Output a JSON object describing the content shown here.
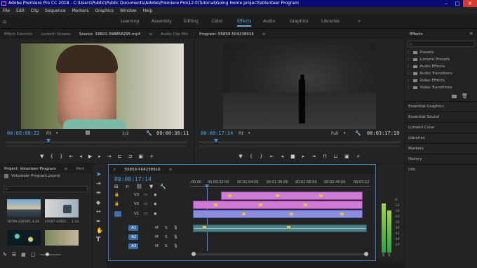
{
  "title_bar": {
    "text": "Adobe Premiere Pro CC 2018 - C:\\Users\\Public\\Public Documents\\Adobe\\Premiere Pro\\12.0\\Tutorial\\Going Home project\\Volunteer Program"
  },
  "menu": [
    "File",
    "Edit",
    "Clip",
    "Sequence",
    "Markers",
    "Graphics",
    "Window",
    "Help"
  ],
  "workspaces": [
    "Learning",
    "Assembly",
    "Editing",
    "Color",
    "Effects",
    "Audio",
    "Graphics",
    "Libraries"
  ],
  "active_workspace": "Effects",
  "source_panel": {
    "tabs": [
      "Effect Controls",
      "Lumetri Scopes",
      "Source: 33601-398856295.mp4",
      "Audio Clip Mix"
    ],
    "timecode_in": "00:00:08:22",
    "fit": "Fit",
    "resolution": "1/2",
    "timecode_out": "00:00:30:11"
  },
  "program_panel": {
    "tab": "Program: 55859-504238916",
    "timecode_in": "00:00:17:14",
    "fit": "Fit",
    "resolution": "Full",
    "timecode_out": "00:03:17:19"
  },
  "effects_panel": {
    "tab": "Effects",
    "folders": [
      "Presets",
      "Lumetri Presets",
      "Audio Effects",
      "Audio Transitions",
      "Video Effects",
      "Video Transitions"
    ],
    "side_panels": [
      "Essential Graphics",
      "Essential Sound",
      "Lumetri Color",
      "Libraries",
      "Markers",
      "History",
      "Info"
    ]
  },
  "project_panel": {
    "tabs": [
      "Project: Volunteer Program",
      "Med"
    ],
    "project_file": "Volunteer Program.prproj",
    "items": [
      {
        "name": "16799-226565...",
        "duration": "4:26"
      },
      {
        "name": "29267-41921...",
        "duration": "1:10"
      }
    ]
  },
  "timeline": {
    "tab": "55859-504238916",
    "timecode": "00:00:17:14",
    "ruler": [
      ":00:00",
      "00:00:32:00",
      "00:01:04:00",
      "00:01:36:00",
      "00:02:08:00",
      "00:02:40:00",
      "00:03:12"
    ],
    "video_tracks": [
      "V3",
      "V2",
      "V1"
    ],
    "audio_tracks": [
      "A1",
      "A2",
      "A3"
    ],
    "track_buttons": [
      "M",
      "S"
    ]
  },
  "meter": {
    "scale": [
      "-6",
      "-12",
      "-18",
      "-24",
      "-30",
      "-36",
      "-42",
      "-48",
      "-54"
    ],
    "footer": [
      "S",
      "S"
    ]
  },
  "colors": {
    "accent": "#47a9ee",
    "video_clip": "#d07ad8",
    "video_clip_alt": "#8a8ee0",
    "audio_clip": "#4d7d84",
    "titlebar": "#070a72"
  }
}
